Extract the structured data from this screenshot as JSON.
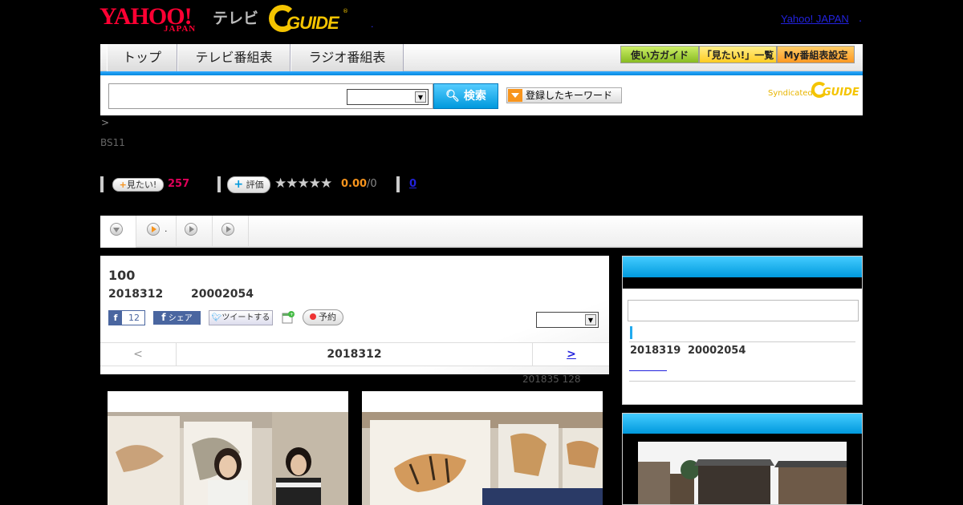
{
  "header": {
    "logo_yahoo": "YAHOO!",
    "logo_japan": "JAPAN",
    "logo_tv": "テレビ",
    "logo_gguide": "GUIDE",
    "yahoo_link": "Yahoo! JAPAN",
    "link_dot": "."
  },
  "nav": {
    "tabs": [
      "トップ",
      "テレビ番組表",
      "ラジオ番組表"
    ],
    "right": [
      "使い方ガイド",
      "「見たい!」一覧",
      "My番組表設定"
    ]
  },
  "search": {
    "button": "検索",
    "keyword_button": "登録したキーワード",
    "syndicated": "Syndicated",
    "syndicated_guide": "GUIDE"
  },
  "breadcrumb": ">",
  "channel": "BS11",
  "actions": {
    "miru_label": "見たい!",
    "miru_count": "257",
    "hyoka_label": "評価",
    "stars": "★★★★★",
    "score": "0.00",
    "score_denom": "/0",
    "review_count": "0"
  },
  "subtabs": {
    "second_label": "."
  },
  "program": {
    "title": "100",
    "date": "2018312",
    "time": "20002054",
    "fb_like_count": "12",
    "fb_share": "シェア",
    "tweet": "ツイートする",
    "reserve": "予約",
    "pager_prev": "<",
    "pager_date": "2018312",
    "pager_next": ">",
    "meta": "201835  128"
  },
  "sidebar": {
    "date": "2018319",
    "time": "20002054"
  },
  "colors": {
    "accent_blue": "#0099dd",
    "miru_pink": "#e0005a",
    "score_orange": "#f7941d",
    "gguide_yellow": "#f4c400",
    "yahoo_red": "#ff0033"
  }
}
